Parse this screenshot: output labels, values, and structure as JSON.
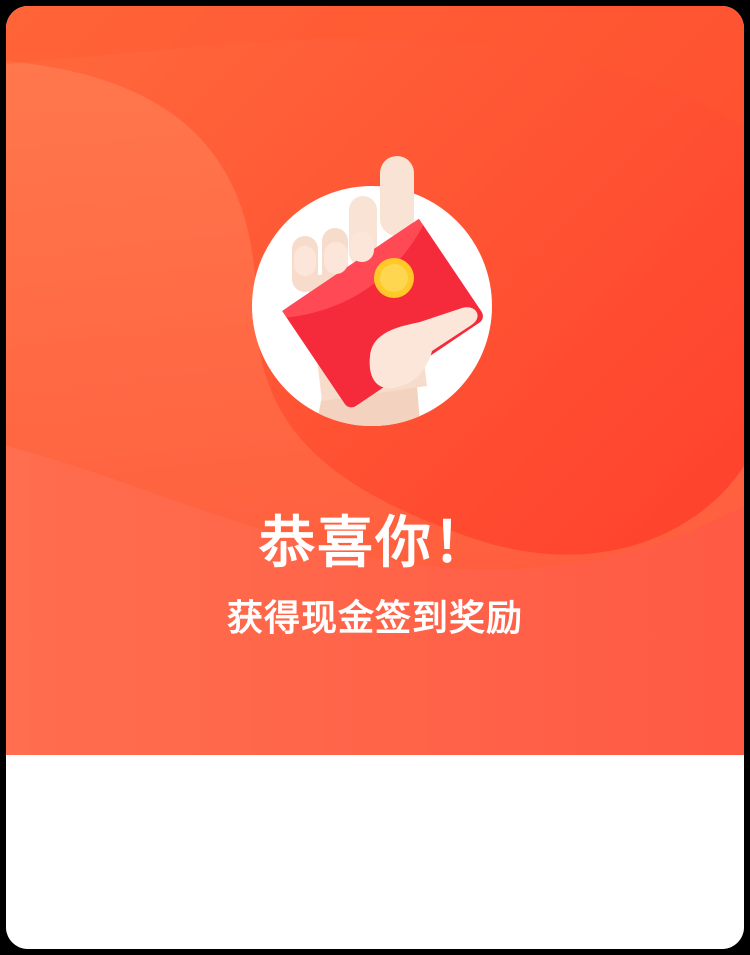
{
  "dialog": {
    "title": "恭喜你！",
    "subtitle": "获得现金签到奖励",
    "illustration": "hand-holding-red-envelope-icon"
  },
  "colors": {
    "hero_top": "#ff4a2c",
    "hero_mid": "#ff3d2e",
    "hero_bottom": "#ff6a4a",
    "envelope": "#f52a3a",
    "coin": "#ffc928",
    "skin": "#f7dccb",
    "text": "#ffffff",
    "panel": "#ffffff"
  }
}
